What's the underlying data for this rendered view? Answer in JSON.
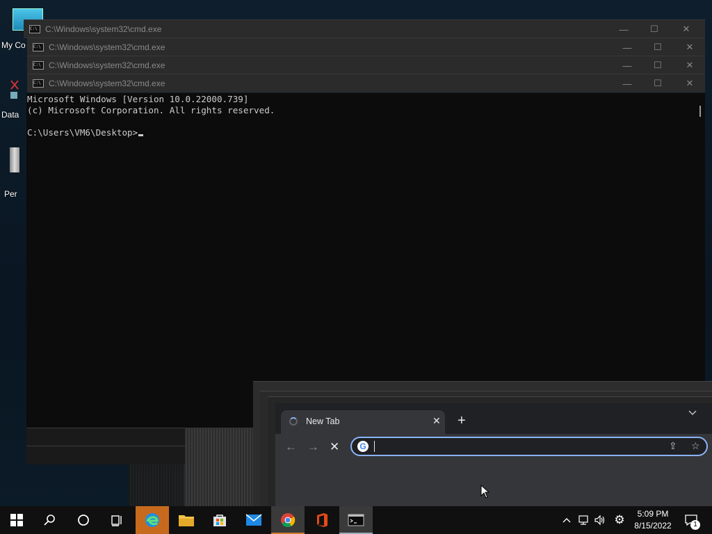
{
  "desktop": {
    "icons": [
      {
        "label": "My Co",
        "icon": "monitor-icon"
      },
      {
        "label": "Data",
        "icon": "shortcut-icon"
      },
      {
        "label": "Per",
        "icon": "file-icon"
      }
    ]
  },
  "cmd_windows": [
    {
      "title": "C:\\Windows\\system32\\cmd.exe"
    },
    {
      "title": "C:\\Windows\\system32\\cmd.exe"
    },
    {
      "title": "C:\\Windows\\system32\\cmd.exe"
    },
    {
      "title": "C:\\Windows\\system32\\cmd.exe"
    }
  ],
  "window_controls": {
    "minimize": "—",
    "maximize": "☐",
    "close": "✕"
  },
  "console": {
    "lines": [
      "Microsoft Windows [Version 10.0.22000.739]",
      "(c) Microsoft Corporation. All rights reserved.",
      "",
      "C:\\Users\\VM6\\Desktop>"
    ]
  },
  "chrome": {
    "tab_title": "New Tab",
    "tab_close": "✕",
    "new_tab": "+",
    "tab_menu": "⌄",
    "back": "←",
    "forward": "→",
    "stop": "✕",
    "omnibox_value": "",
    "google_icon": "G",
    "share_icon": "⇪",
    "star_icon": "☆"
  },
  "taskbar": {
    "apps": [
      {
        "name": "start-button",
        "icon": "windows-icon"
      },
      {
        "name": "search-button",
        "icon": "search-icon"
      },
      {
        "name": "cortana-button",
        "icon": "circle-icon"
      },
      {
        "name": "task-view-button",
        "icon": "task-view-icon"
      },
      {
        "name": "edge-button",
        "icon": "edge-icon"
      },
      {
        "name": "file-explorer-button",
        "icon": "folder-icon"
      },
      {
        "name": "store-button",
        "icon": "store-icon"
      },
      {
        "name": "mail-button",
        "icon": "mail-icon"
      },
      {
        "name": "chrome-button",
        "icon": "chrome-icon"
      },
      {
        "name": "office-button",
        "icon": "office-icon"
      },
      {
        "name": "terminal-button",
        "icon": "cmd-icon"
      }
    ],
    "tray": {
      "chevron": "^",
      "network": "🖧",
      "volume": "🔊",
      "settings": "⚙",
      "notifications_count": "1"
    },
    "clock": {
      "time": "5:09 PM",
      "date": "8/15/2022"
    }
  },
  "colors": {
    "console_bg": "#0c0c0c",
    "console_fg": "#cccccc",
    "chrome_accent": "#8ab4f8",
    "taskbar_bg": "#101010",
    "active_app": "#c86a1e"
  }
}
